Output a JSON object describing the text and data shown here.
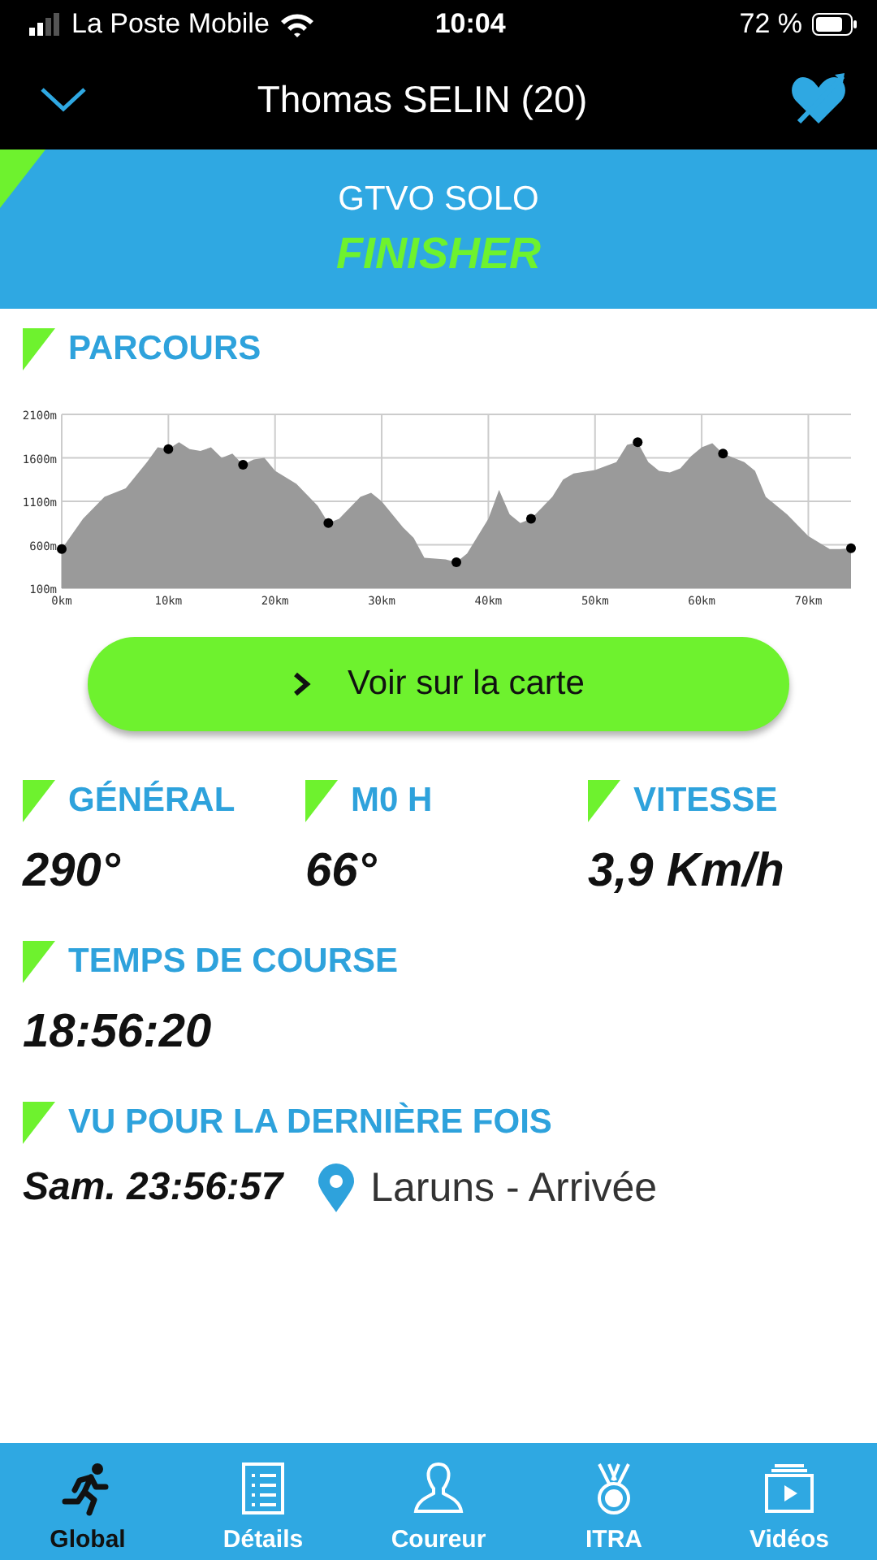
{
  "status_bar": {
    "carrier": "La Poste Mobile",
    "time": "10:04",
    "battery": "72 %"
  },
  "header": {
    "title": "Thomas SELIN (20)"
  },
  "banner": {
    "race": "GTVO SOLO",
    "status": "FINISHER"
  },
  "profile": {
    "title": "PARCOURS",
    "chart_data": {
      "type": "area",
      "xlim": [
        0,
        74
      ],
      "ylim": [
        100,
        2100
      ],
      "xticks": [
        {
          "value": 0,
          "label": "0km"
        },
        {
          "value": 10,
          "label": "10km"
        },
        {
          "value": 20,
          "label": "20km"
        },
        {
          "value": 30,
          "label": "30km"
        },
        {
          "value": 40,
          "label": "40km"
        },
        {
          "value": 50,
          "label": "50km"
        },
        {
          "value": 60,
          "label": "60km"
        },
        {
          "value": 70,
          "label": "70km"
        }
      ],
      "yticks": [
        {
          "value": 100,
          "label": "100m"
        },
        {
          "value": 600,
          "label": "600m"
        },
        {
          "value": 1100,
          "label": "1100m"
        },
        {
          "value": 1600,
          "label": "1600m"
        },
        {
          "value": 2100,
          "label": "2100m"
        }
      ],
      "x": [
        0,
        2,
        4,
        6,
        8,
        9,
        10,
        11,
        12,
        13,
        14,
        15,
        16,
        17,
        18,
        19,
        20,
        22,
        24,
        25,
        26,
        28,
        29,
        30,
        32,
        33,
        34,
        36,
        37,
        38,
        40,
        41,
        42,
        43,
        44,
        46,
        47,
        48,
        50,
        52,
        53,
        54,
        55,
        56,
        57,
        58,
        59,
        60,
        61,
        62,
        64,
        65,
        66,
        68,
        70,
        72,
        73,
        74
      ],
      "grid": true,
      "series": [
        {
          "color": "#9a9a9a",
          "values": [
            550,
            900,
            1150,
            1250,
            1550,
            1720,
            1700,
            1780,
            1700,
            1680,
            1720,
            1600,
            1650,
            1520,
            1580,
            1600,
            1450,
            1300,
            1050,
            850,
            900,
            1150,
            1200,
            1100,
            800,
            680,
            450,
            430,
            400,
            500,
            900,
            1230,
            950,
            850,
            900,
            1150,
            1350,
            1420,
            1460,
            1550,
            1750,
            1780,
            1550,
            1450,
            1430,
            1480,
            1620,
            1720,
            1770,
            1650,
            1550,
            1450,
            1150,
            950,
            700,
            550,
            550,
            560
          ]
        },
        {
          "type": "scatter",
          "color": "#000000",
          "values": [
            550,
            null,
            null,
            null,
            null,
            null,
            1700,
            null,
            null,
            null,
            null,
            null,
            null,
            1520,
            null,
            null,
            null,
            null,
            null,
            850,
            null,
            null,
            null,
            null,
            null,
            null,
            null,
            null,
            400,
            null,
            null,
            null,
            null,
            null,
            900,
            null,
            null,
            null,
            null,
            null,
            null,
            1780,
            null,
            null,
            null,
            null,
            null,
            null,
            null,
            1650,
            null,
            null,
            null,
            null,
            null,
            null,
            null,
            560
          ]
        }
      ]
    }
  },
  "map_button": {
    "label": "Voir sur la carte"
  },
  "stats": [
    {
      "label": "GÉNÉRAL",
      "value": "290°"
    },
    {
      "label": "M0 H",
      "value": "66°"
    },
    {
      "label": "VITESSE",
      "value": "3,9 Km/h"
    }
  ],
  "race_time": {
    "label": "TEMPS DE COURSE",
    "value": "18:56:20"
  },
  "last_seen": {
    "label": "VU POUR LA DERNIÈRE FOIS",
    "time": "Sam. 23:56:57",
    "place": "Laruns - Arrivée"
  },
  "tabs": [
    {
      "label": "Global",
      "selected": true
    },
    {
      "label": "Détails",
      "selected": false
    },
    {
      "label": "Coureur",
      "selected": false
    },
    {
      "label": "ITRA",
      "selected": false
    },
    {
      "label": "Vidéos",
      "selected": false
    }
  ]
}
